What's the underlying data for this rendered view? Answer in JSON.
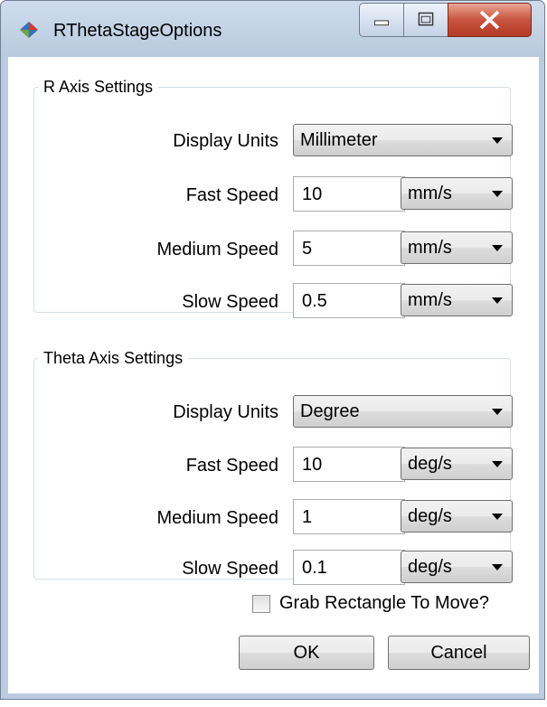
{
  "window": {
    "title": "RThetaStageOptions",
    "icon": "diamond-app-icon",
    "controls": [
      "minimize-icon",
      "maximize-icon",
      "close-icon"
    ]
  },
  "r_axis": {
    "legend": "R Axis Settings",
    "display_units_label": "Display Units",
    "display_units_value": "Millimeter",
    "fast_speed_label": "Fast Speed",
    "fast_speed_value": "10",
    "fast_speed_unit": "mm/s",
    "medium_speed_label": "Medium Speed",
    "medium_speed_value": "5",
    "medium_speed_unit": "mm/s",
    "slow_speed_label": "Slow Speed",
    "slow_speed_value": "0.5",
    "slow_speed_unit": "mm/s"
  },
  "theta_axis": {
    "legend": "Theta Axis Settings",
    "display_units_label": "Display Units",
    "display_units_value": "Degree",
    "fast_speed_label": "Fast Speed",
    "fast_speed_value": "10",
    "fast_speed_unit": "deg/s",
    "medium_speed_label": "Medium Speed",
    "medium_speed_value": "1",
    "medium_speed_unit": "deg/s",
    "slow_speed_label": "Slow Speed",
    "slow_speed_value": "0.1",
    "slow_speed_unit": "deg/s"
  },
  "grab_rectangle": {
    "label": "Grab Rectangle To Move?",
    "checked": false
  },
  "buttons": {
    "ok_label": "OK",
    "cancel_label": "Cancel"
  }
}
